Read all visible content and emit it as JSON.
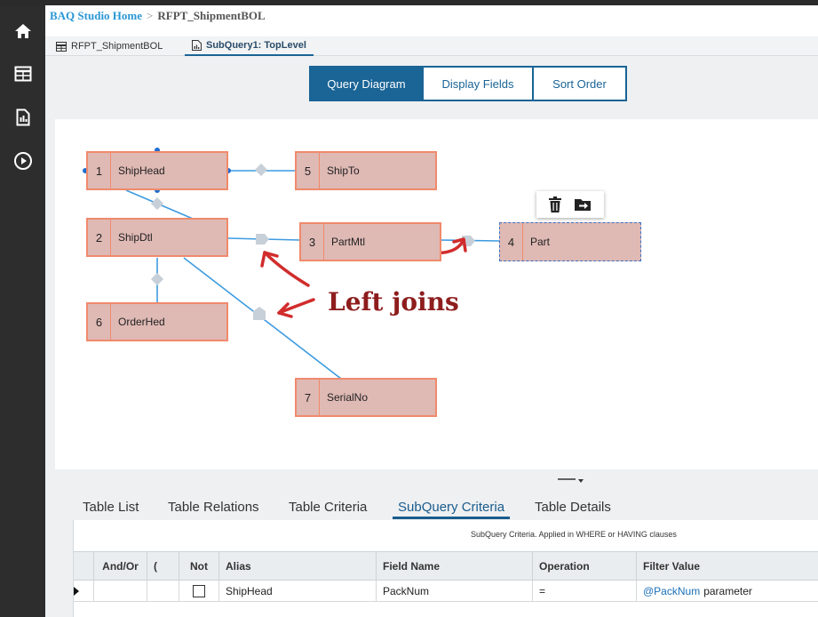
{
  "app": {
    "breadcrumb": {
      "home": "BAQ Studio Home",
      "separator": ">",
      "current": "RFPT_ShipmentBOL"
    },
    "nav_icons": [
      "home-icon",
      "grid-icon",
      "report-icon",
      "play-icon"
    ]
  },
  "doc_tabs": [
    {
      "label": "RFPT_ShipmentBOL",
      "icon": "table-icon"
    },
    {
      "label": "SubQuery1: TopLevel",
      "icon": "chart-icon",
      "active": true
    }
  ],
  "view_tabs": [
    {
      "label": "Query Diagram",
      "active": true
    },
    {
      "label": "Display Fields"
    },
    {
      "label": "Sort Order"
    }
  ],
  "diagram": {
    "nodes": [
      {
        "num": "1",
        "name": "ShipHead"
      },
      {
        "num": "5",
        "name": "ShipTo"
      },
      {
        "num": "2",
        "name": "ShipDtl"
      },
      {
        "num": "3",
        "name": "PartMtl"
      },
      {
        "num": "4",
        "name": "Part",
        "selected": true
      },
      {
        "num": "6",
        "name": "OrderHed"
      },
      {
        "num": "7",
        "name": "SerialNo"
      }
    ],
    "toolbar": {
      "delete_icon": "trash-icon",
      "export_icon": "export-icon"
    },
    "annotation": "Left joins",
    "accent_color": "#c62828"
  },
  "bottom_tabs": [
    {
      "label": "Table List"
    },
    {
      "label": "Table Relations"
    },
    {
      "label": "Table Criteria"
    },
    {
      "label": "SubQuery Criteria",
      "active": true
    },
    {
      "label": "Table Details"
    }
  ],
  "criteria": {
    "hint": "SubQuery Criteria. Applied in WHERE or HAVING clauses",
    "columns": [
      "And/Or",
      "(",
      "Not",
      "Alias",
      "Field Name",
      "Operation",
      "Filter Value"
    ],
    "rows": [
      {
        "and_or": "",
        "paren": "",
        "not": false,
        "alias": "ShipHead",
        "field": "PackNum",
        "operation": "=",
        "filter_param": "@PackNum",
        "filter_suffix": "parameter"
      }
    ]
  }
}
